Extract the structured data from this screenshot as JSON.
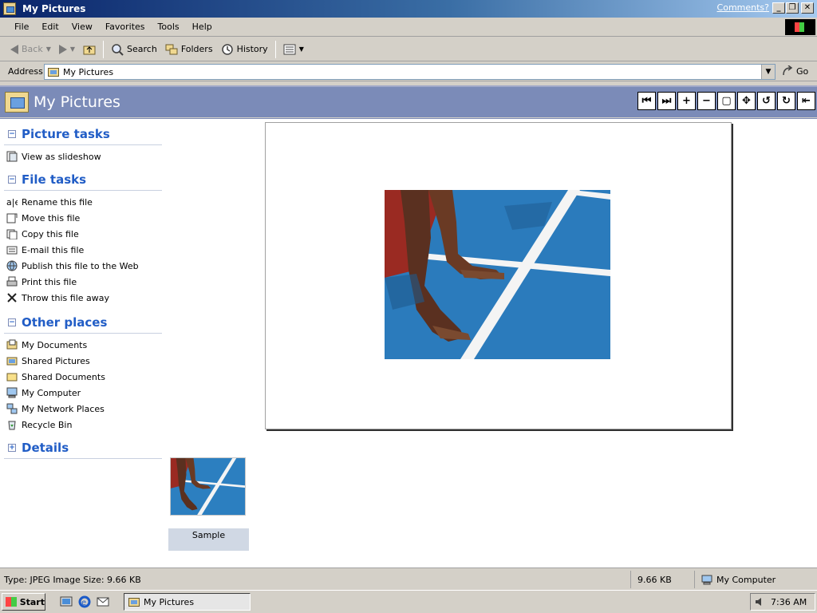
{
  "window": {
    "title": "My Pictures",
    "comments_link": "Comments?"
  },
  "menu": [
    "File",
    "Edit",
    "View",
    "Favorites",
    "Tools",
    "Help"
  ],
  "toolbar": {
    "back": "Back",
    "search": "Search",
    "folders": "Folders",
    "history": "History"
  },
  "address": {
    "label": "Address",
    "value": "My Pictures",
    "go": "Go"
  },
  "header": {
    "title": "My Pictures"
  },
  "viewer_tools": [
    "previous-image-icon",
    "next-image-icon",
    "zoom-in-icon",
    "zoom-out-icon",
    "best-fit-icon",
    "actual-size-icon",
    "rotate-counterclockwise-icon",
    "rotate-clockwise-icon",
    "exit-icon"
  ],
  "taskpane": {
    "picture_tasks": {
      "title": "Picture tasks",
      "items": [
        "View as slideshow"
      ]
    },
    "file_tasks": {
      "title": "File tasks",
      "items": [
        "Rename this file",
        "Move this file",
        "Copy this file",
        "E-mail this file",
        "Publish this file to the Web",
        "Print this file",
        "Throw this file away"
      ]
    },
    "other_places": {
      "title": "Other places",
      "items": [
        "My Documents",
        "Shared Pictures",
        "Shared Documents",
        "My Computer",
        "My Network Places",
        "Recycle Bin"
      ]
    },
    "details": {
      "title": "Details"
    }
  },
  "thumbnail": {
    "label": "Sample"
  },
  "status": {
    "left": "Type: JPEG Image Size: 9.66 KB",
    "size": "9.66 KB",
    "zone": "My Computer"
  },
  "taskbar": {
    "start": "Start",
    "task": "My Pictures",
    "clock": "7:36 AM"
  },
  "colors": {
    "title_bar": "#0a246a",
    "header_band": "#7b8bb8",
    "task_heading": "#215dc6",
    "track_blue": "#2c7fc0"
  }
}
